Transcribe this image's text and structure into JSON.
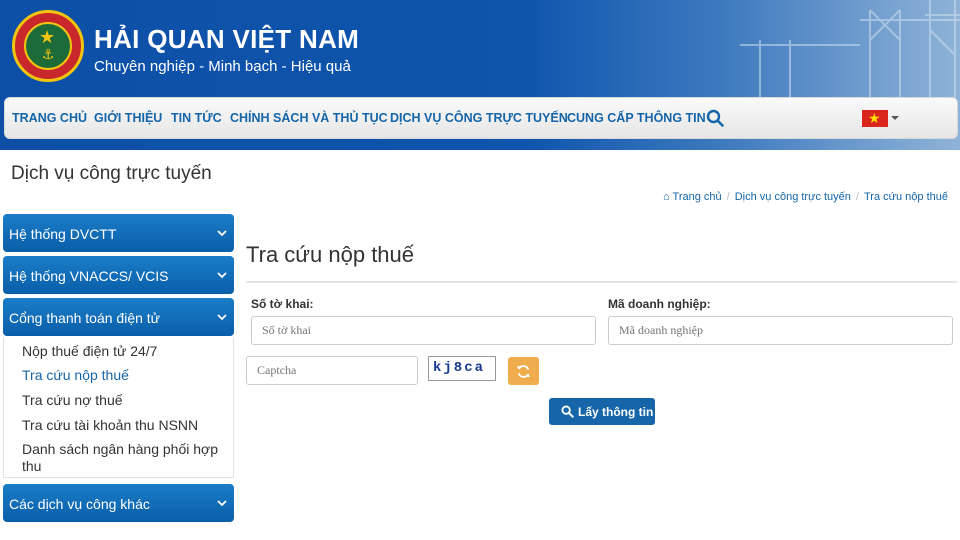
{
  "header": {
    "logo_text": "HẢI QUAN VIỆT NAM · VIETNAM CUSTOMS",
    "title": "HẢI QUAN VIỆT NAM",
    "slogan": "Chuyên nghiệp - Minh bạch - Hiệu quả"
  },
  "nav": {
    "items": [
      {
        "label": "TRANG CHỦ"
      },
      {
        "label": "GIỚI THIỆU"
      },
      {
        "label": "TIN TỨC"
      },
      {
        "label": "CHÍNH SÁCH VÀ THỦ TỤC"
      },
      {
        "label": "DỊCH VỤ CÔNG TRỰC TUYẾN"
      },
      {
        "label": "CUNG CẤP THÔNG TIN"
      }
    ],
    "search_icon": "search-icon",
    "language_flag": "vietnam-flag-icon",
    "accent_color": "#1565a8"
  },
  "page": {
    "title": "Dịch vụ công trực tuyến"
  },
  "breadcrumb": {
    "home": "Trang chủ",
    "level1": "Dịch vụ công trực tuyến",
    "current": "Tra cứu nộp thuế"
  },
  "sidebar": {
    "groups": [
      {
        "label": "Hệ thống DVCTT"
      },
      {
        "label": "Hệ thống VNACCS/ VCIS"
      },
      {
        "label": "Cổng thanh toán điện tử"
      },
      {
        "label": "Các dịch vụ công khác"
      }
    ],
    "sub_items": [
      {
        "label": "Nộp thuế điện tử 24/7"
      },
      {
        "label": "Tra cứu nộp thuế",
        "active": true
      },
      {
        "label": "Tra cứu nợ thuế"
      },
      {
        "label": "Tra cứu tài khoản thu NSNN"
      },
      {
        "label": "Danh sách ngân hàng phối hợp thu"
      }
    ]
  },
  "form": {
    "title": "Tra cứu nộp thuế",
    "so_to_khai_label": "Số tờ khai:",
    "so_to_khai_placeholder": "Số tờ khai",
    "so_to_khai_value": "",
    "ma_dn_label": "Mã doanh nghiệp:",
    "ma_dn_placeholder": "Mã doanh nghiệp",
    "ma_dn_value": "",
    "captcha_placeholder": "Captcha",
    "captcha_value": "",
    "captcha_text": "kj8ca",
    "submit_label": "Lấy thông tin",
    "refresh_color": "#f0ad4e"
  }
}
